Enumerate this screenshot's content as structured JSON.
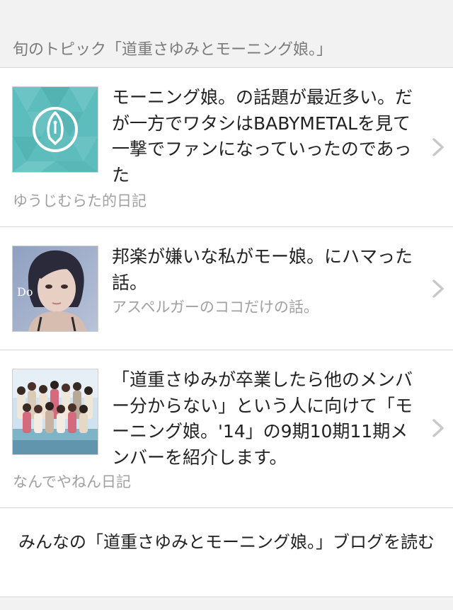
{
  "section": {
    "title": "旬のトピック「道重さゆみとモーニング娘。」"
  },
  "items": [
    {
      "headline": "モーニング娘。の話題が最近多い。だが一方でワタシはBABYMETALを見て一撃でファンになっていったのであった",
      "source": "ゆうじむらた的日記",
      "thumb_icon": "fountain-pen-icon",
      "thumb_color": "#5dbcbc"
    },
    {
      "headline": "邦楽が嫌いな私がモー娘。にハマった話。",
      "source": "アスペルガーのココだけの話。",
      "thumb_text": "Do"
    },
    {
      "headline": "「道重さゆみが卒業したら他のメンバー分からない」という人に向けて「モーニング娘。'14」の9期10期11期メンバーを紹介します。",
      "source": "なんでやねん日記"
    }
  ],
  "footer": {
    "link_label": "みんなの「道重さゆみとモーニング娘。」ブログを読む"
  },
  "colors": {
    "background": "#f2f2f2",
    "divider": "#d6d6d6",
    "secondary_text": "#a0a0a0",
    "chevron": "#c8c8c8"
  }
}
